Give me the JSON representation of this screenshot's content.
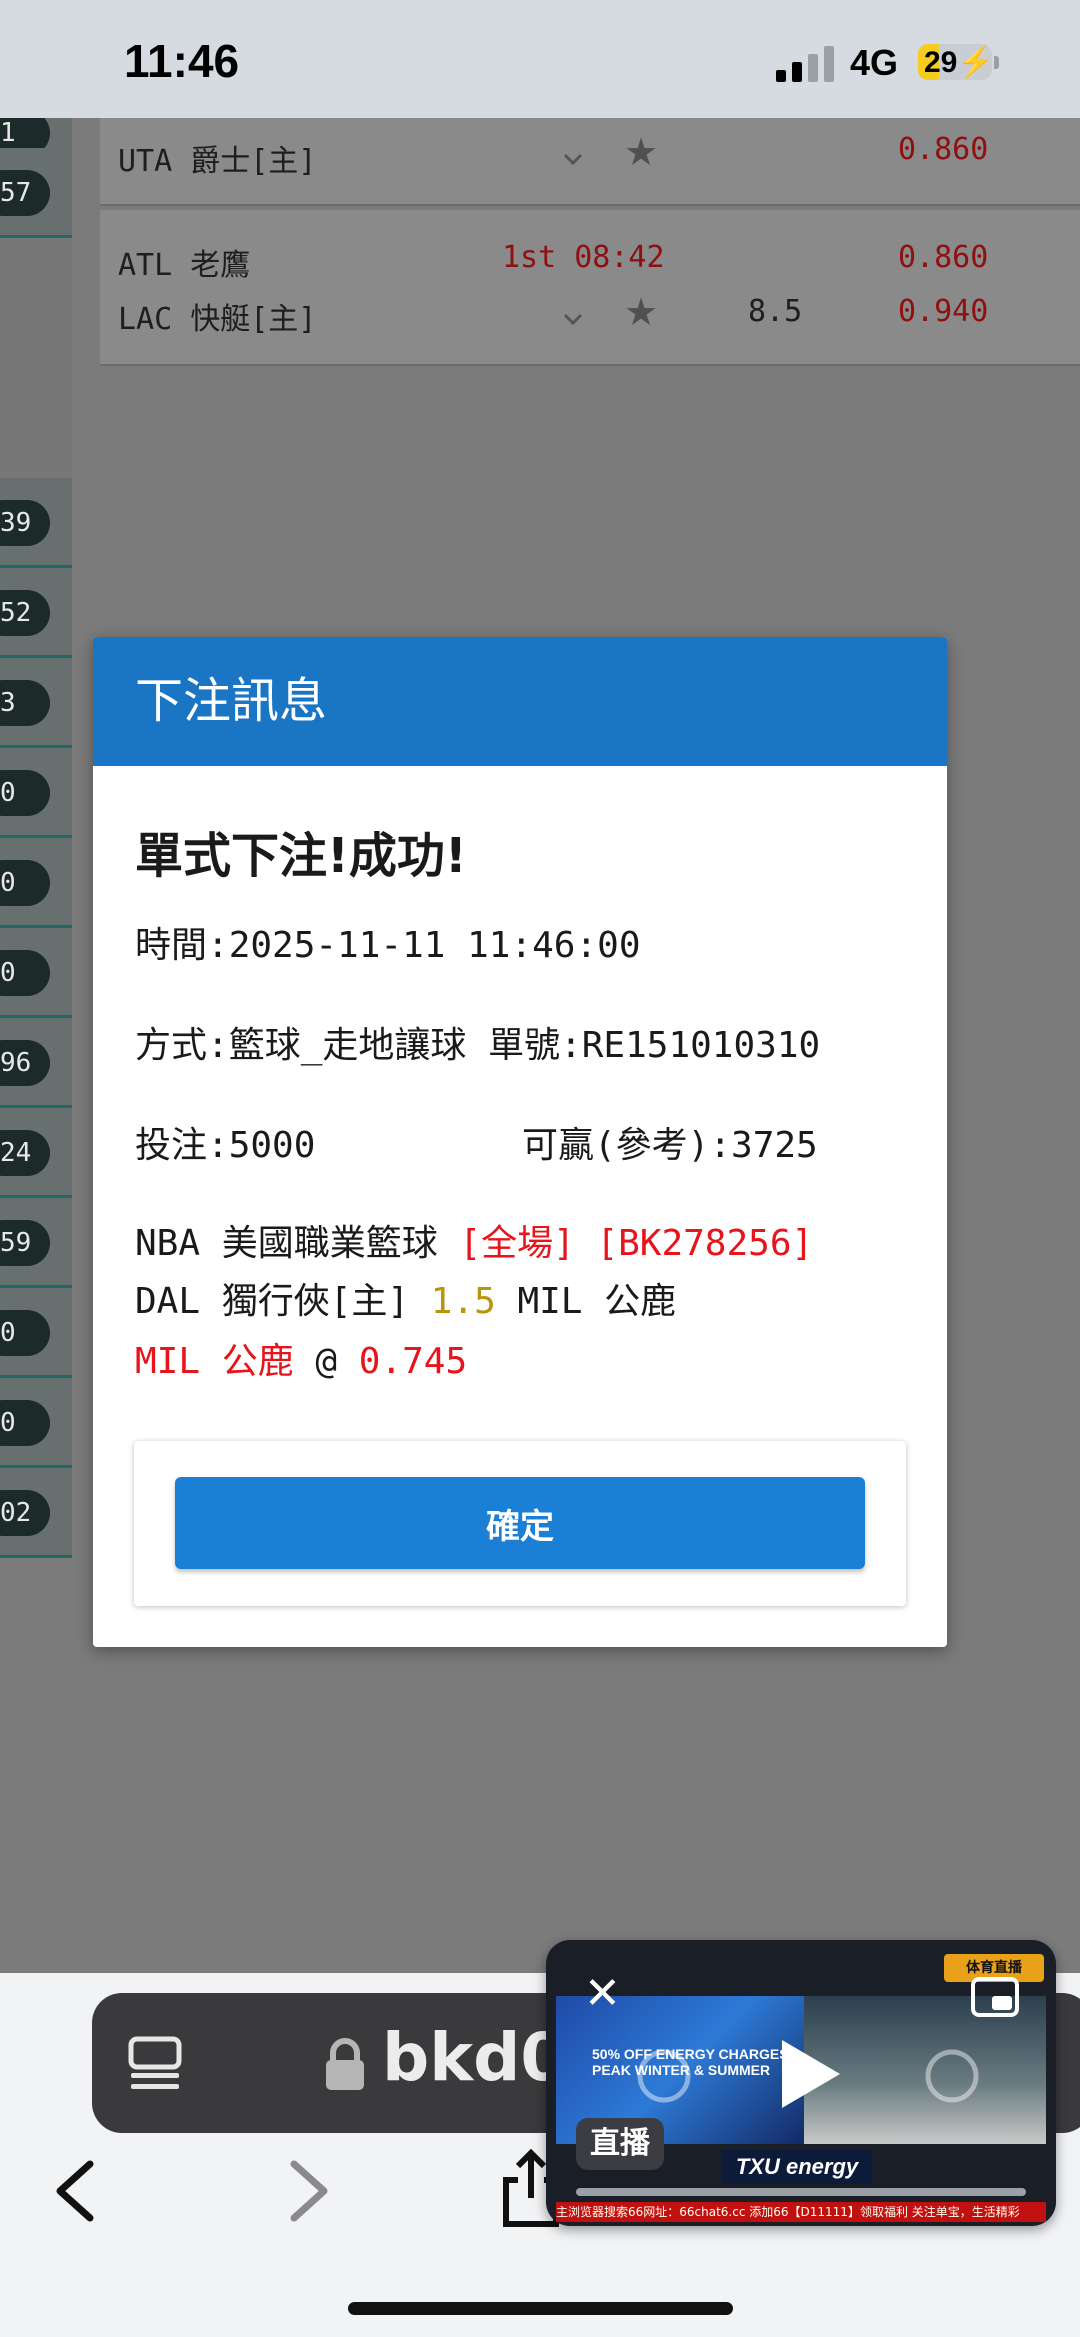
{
  "status_bar": {
    "time": "11:46",
    "network": "4G",
    "battery": "29",
    "battery_level": 0.29
  },
  "background": {
    "left_pills": [
      "1",
      "57",
      "",
      "",
      "",
      "39",
      "52",
      "3",
      "0",
      "0",
      "0",
      "96",
      "24",
      "59",
      "0",
      "0",
      "02"
    ],
    "matches": [
      {
        "home": "",
        "away": "UTA 爵士[主]",
        "time": "",
        "line": "",
        "odds_top": "0.860",
        "odds_bottom": ""
      },
      {
        "home": "ATL 老鷹",
        "away": "LAC 快艇[主]",
        "time": "1st 08:42",
        "line": "8.5",
        "odds_top": "0.860",
        "odds_bottom": "0.940"
      }
    ]
  },
  "modal": {
    "title": "下注訊息",
    "success": "單式下注!成功!",
    "time_label": "時間:",
    "time_value": "2025-11-11 11:46:00",
    "method_label": "方式:",
    "method_value": "籃球_走地讓球",
    "order_label": "單號:",
    "order_value": "RE151010310",
    "stake_label": "投注:",
    "stake_value": "5000",
    "win_label": "可贏(參考):",
    "win_value": "3725",
    "league": "NBA 美國職業籃球",
    "period": "[全場]",
    "event_code": "[BK278256]",
    "home_team": "DAL 獨行俠[主]",
    "handicap": "1.5",
    "away_team": "MIL 公鹿",
    "pick": "MIL 公鹿",
    "at": "@",
    "pick_odds": "0.745",
    "confirm": "確定"
  },
  "browser": {
    "url": "bkd0"
  },
  "pip": {
    "live_label": "直播",
    "ad_text": "50% OFF ENERGY CHARGES PEAK WINTER & SUMMER",
    "brand": "TXU energy",
    "logo": "体育直播",
    "ticker": "主浏览器搜索66网址：66chat6.cc 添加66【D11111】领取福利 关注单宝，生活精彩"
  }
}
